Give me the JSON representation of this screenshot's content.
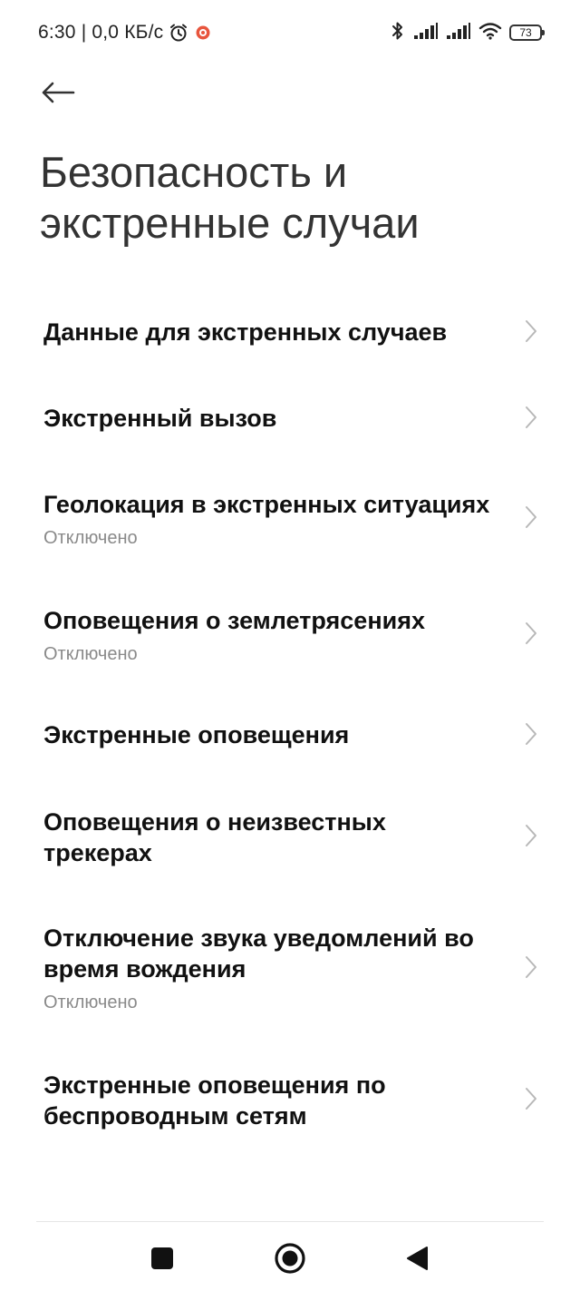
{
  "status_bar": {
    "time_and_speed": "6:30 | 0,0 КБ/с",
    "battery_level": "73"
  },
  "header": {
    "title": "Безопасность и экстренные случаи"
  },
  "items": [
    {
      "title": "Данные для экстренных случаев",
      "subtitle": ""
    },
    {
      "title": "Экстренный вызов",
      "subtitle": ""
    },
    {
      "title": "Геолокация в экстренных ситуациях",
      "subtitle": "Отключено"
    },
    {
      "title": "Оповещения о землетрясениях",
      "subtitle": "Отключено"
    },
    {
      "title": "Экстренные оповещения",
      "subtitle": ""
    },
    {
      "title": "Оповещения о неизвестных трекерах",
      "subtitle": ""
    },
    {
      "title": "Отключение звука уведомлений во время вождения",
      "subtitle": "Отключено"
    },
    {
      "title": "Экстренные оповещения по беспроводным сетям",
      "subtitle": ""
    }
  ],
  "icons": {
    "back": "back-arrow-icon",
    "chevron": "chevron-right-icon",
    "nav_recents": "square-icon",
    "nav_home": "circle-icon",
    "nav_back": "triangle-back-icon"
  },
  "colors": {
    "background": "#ffffff",
    "title_text": "#333333",
    "item_text": "#111111",
    "subtitle_text": "#8a8a8a",
    "chevron": "#b8b8b8"
  }
}
